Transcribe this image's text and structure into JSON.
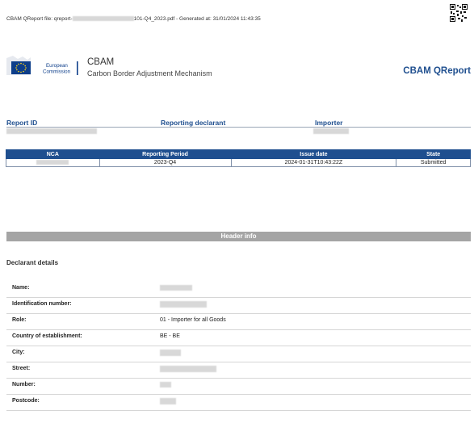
{
  "header": {
    "file_prefix": "CBAM QReport file: qreport-",
    "file_suffix": "101-Q4_2023.pdf - Generated at: 31/01/2024 11:43:35"
  },
  "brand": {
    "ec_line1": "European",
    "ec_line2": "Commission",
    "cbam": "CBAM",
    "cbam_full": "Carbon Border Adjustment Mechanism",
    "qreport": "CBAM QReport"
  },
  "meta": {
    "report_id_label": "Report ID",
    "declarant_label": "Reporting declarant",
    "importer_label": "Importer"
  },
  "summary": {
    "headers": [
      "NCA",
      "Reporting Period",
      "Issue date",
      "State"
    ],
    "row": {
      "nca": "",
      "period": "2023-Q4",
      "issue_date": "2024-01-31T10:43:22Z",
      "state": "Submitted"
    }
  },
  "section": {
    "header_info": "Header info"
  },
  "declarant": {
    "title": "Declarant details",
    "fields": [
      {
        "label": "Name:",
        "value": ""
      },
      {
        "label": "Identification number:",
        "value": ""
      },
      {
        "label": "Role:",
        "value": "01 - Importer for all Goods"
      },
      {
        "label": "Country of establishment:",
        "value": "BE - BE"
      },
      {
        "label": "City:",
        "value": ""
      },
      {
        "label": "Street:",
        "value": ""
      },
      {
        "label": "Number:",
        "value": ""
      },
      {
        "label": "Postcode:",
        "value": ""
      }
    ]
  },
  "colors": {
    "brand_blue": "#1f4f8f",
    "section_grey": "#a5a5a5",
    "eu_blue": "#0d3e8a",
    "eu_star": "#ffd617"
  }
}
